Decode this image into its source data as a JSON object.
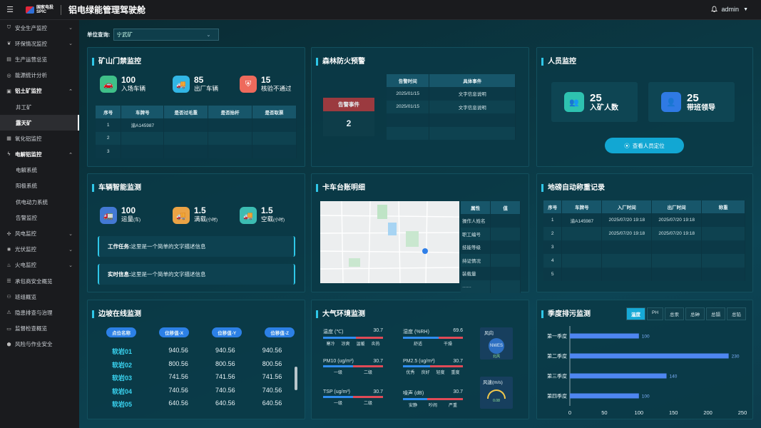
{
  "app": {
    "menu_icon": "☰",
    "logo_line1": "国家电投",
    "logo_line2": "SPIC",
    "title": "铝电绿能管理驾驶舱",
    "user": "admin"
  },
  "sidebar": {
    "items": [
      {
        "label": "安全生产监控",
        "icon": "shield-icon",
        "chevron": "down"
      },
      {
        "label": "环保情况监控",
        "icon": "leaf-icon",
        "chevron": "down"
      },
      {
        "label": "生产运营总览",
        "icon": "doc-icon"
      },
      {
        "label": "能源统计分析",
        "icon": "ring-icon"
      },
      {
        "label": "铝土矿监控",
        "icon": "box-icon",
        "chevron": "up",
        "open": true,
        "children": [
          "井工矿",
          "露天矿"
        ]
      },
      {
        "label": "氧化铝监控",
        "icon": "chip-icon"
      },
      {
        "label": "电解铝监控",
        "icon": "bolt-icon",
        "chevron": "up",
        "open": true,
        "children": [
          "电解系统",
          "阳极系统",
          "供电动力系统",
          "告警监控"
        ]
      },
      {
        "label": "风电监控",
        "icon": "fan-icon",
        "chevron": "down"
      },
      {
        "label": "光伏监控",
        "icon": "sun-icon",
        "chevron": "down"
      },
      {
        "label": "火电监控",
        "icon": "fire-icon",
        "chevron": "down"
      },
      {
        "label": "承包商安全概览",
        "icon": "list-icon"
      },
      {
        "label": "班组概览",
        "icon": "team-icon"
      },
      {
        "label": "隐患排查与治理",
        "icon": "alert-icon"
      },
      {
        "label": "监督检查概览",
        "icon": "check-icon"
      },
      {
        "label": "风险与作业安全",
        "icon": "risk-icon"
      }
    ],
    "active": "露天矿"
  },
  "filter": {
    "label": "单位查询:",
    "value": "宁武矿"
  },
  "gate": {
    "title": "矿山门禁监控",
    "stats": [
      {
        "value": "100",
        "label": "入场车辆"
      },
      {
        "value": "85",
        "label": "出厂车辆"
      },
      {
        "value": "15",
        "label": "核验不通过"
      }
    ],
    "headers": [
      "序号",
      "车牌号",
      "是否过毛重",
      "是否抬杆",
      "是否取票"
    ],
    "rows": [
      [
        "1",
        "渝A145987",
        "",
        "",
        ""
      ],
      [
        "2",
        "",
        "",
        "",
        ""
      ],
      [
        "3",
        "",
        "",
        "",
        ""
      ]
    ]
  },
  "fire": {
    "title": "森林防火预警",
    "alarm_label": "告警事件",
    "alarm_value": "2",
    "headers": [
      "告警时间",
      "具体事件"
    ],
    "rows": [
      [
        "2025/01/15",
        "文字信息说明"
      ],
      [
        "2025/01/15",
        "文字信息说明"
      ],
      [
        "",
        ""
      ],
      [
        "",
        ""
      ]
    ]
  },
  "people": {
    "title": "人员监控",
    "stats": [
      {
        "value": "25",
        "label": "入矿人数"
      },
      {
        "value": "25",
        "label": "带班领导"
      }
    ],
    "button": "查看人员定位"
  },
  "vehicle": {
    "title": "车辆智能监测",
    "stats": [
      {
        "value": "100",
        "label": "运量",
        "unit": "(车)"
      },
      {
        "value": "1.5",
        "label": "满载",
        "unit": "(小时)"
      },
      {
        "value": "1.5",
        "label": "空载",
        "unit": "(小时)"
      }
    ],
    "task_label": "工作任务:",
    "task_text": "这里是一个简单的文字描述信息",
    "info_label": "实时信息:",
    "info_text": "这里是一个简单的文字描述信息"
  },
  "truck": {
    "title": "卡车台账明细",
    "headers": [
      "属性",
      "值"
    ],
    "rows": [
      "操作人姓名",
      "职工编号",
      "技能等级",
      "持证情况",
      "装载量",
      "……"
    ]
  },
  "scale": {
    "title": "地磅自动称重记录",
    "headers": [
      "序号",
      "车牌号",
      "入厂时间",
      "出厂时间",
      "称重"
    ],
    "rows": [
      [
        "1",
        "渝A145987",
        "2025/07/20  19:18",
        "2025/07/20  19:18",
        ""
      ],
      [
        "2",
        "",
        "2025/07/20  19:18",
        "2025/07/20  19:18",
        ""
      ],
      [
        "3",
        "",
        "",
        "",
        ""
      ],
      [
        "4",
        "",
        "",
        "",
        ""
      ],
      [
        "5",
        "",
        "",
        "",
        ""
      ]
    ]
  },
  "slope": {
    "title": "边坡在线监测",
    "headers": [
      "点位名称",
      "位移值-X",
      "位移值-Y",
      "位移值-Z"
    ],
    "rows": [
      [
        "软岩01",
        "940.56",
        "940.56",
        "940.56"
      ],
      [
        "软岩02",
        "800.56",
        "800.56",
        "800.56"
      ],
      [
        "软岩03",
        "741.56",
        "741.56",
        "741.56"
      ],
      [
        "软岩04",
        "740.56",
        "740.56",
        "740.56"
      ],
      [
        "软岩05",
        "640.56",
        "640.56",
        "640.56"
      ]
    ]
  },
  "air": {
    "title": "大气环境监测",
    "items": [
      {
        "label": "温度 (℃)",
        "value": "30.7",
        "scale": [
          "寒冷",
          "凉爽",
          "温暖",
          "炎热"
        ],
        "fill": 0.55
      },
      {
        "label": "湿度 (%RH)",
        "value": "69.6",
        "scale": [
          "舒适",
          "干燥"
        ],
        "fill": 0.6
      },
      {
        "label": "PM10 (ug/m³)",
        "value": "30.7",
        "scale": [
          "一级",
          "二级"
        ],
        "fill": 0.5
      },
      {
        "label": "PM2.5 (ug/m³)",
        "value": "30.7",
        "scale": [
          "优秀",
          "良好",
          "轻度",
          "重度"
        ],
        "fill": 0.45
      },
      {
        "label": "TSP (ug/m³)",
        "value": "30.7",
        "scale": [
          "一级",
          "二级"
        ],
        "fill": 0.5
      },
      {
        "label": "噪声 (dB)",
        "value": "30.7",
        "scale": [
          "安静",
          "吵闹",
          "严重"
        ],
        "fill": 0.4
      }
    ],
    "wind_dir_label": "风向",
    "wind_dir_value": "北风",
    "wind_speed_label": "风速(m/s)",
    "wind_speed_value": "0.08"
  },
  "season": {
    "title": "季度排污监测",
    "tabs": [
      "温度",
      "PH",
      "总汞",
      "总砷",
      "总镉",
      "总铅"
    ],
    "active_tab": "温度"
  },
  "chart_data": {
    "type": "bar",
    "orientation": "horizontal",
    "categories": [
      "第一季度",
      "第二季度",
      "第三季度",
      "第四季度"
    ],
    "values": [
      100,
      230,
      140,
      100
    ],
    "xlim": [
      0,
      250
    ],
    "xticks": [
      "0",
      "50",
      "100",
      "150",
      "200",
      "250"
    ],
    "color": "#4f86f0"
  }
}
